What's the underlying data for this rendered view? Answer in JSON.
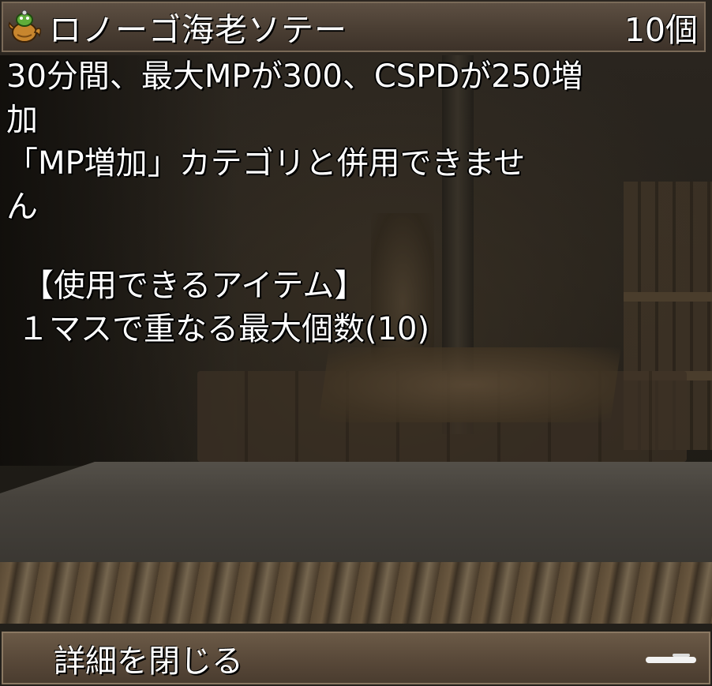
{
  "item": {
    "name": "ロノーゴ海老ソテー",
    "count": "10個",
    "icon": "teapot-food-icon"
  },
  "description": {
    "lines": [
      "30分間、最大MPが300、CSPDが250増",
      "加",
      "「MP増加」カテゴリと併用できませ",
      "ん"
    ],
    "usable_items_heading": "【使用できるアイテム】",
    "stack_info": "１マスで重なる最大個数(10)"
  },
  "footer": {
    "close_label": "詳細を閉じる",
    "handle_icon": "drag-handle-icon"
  }
}
